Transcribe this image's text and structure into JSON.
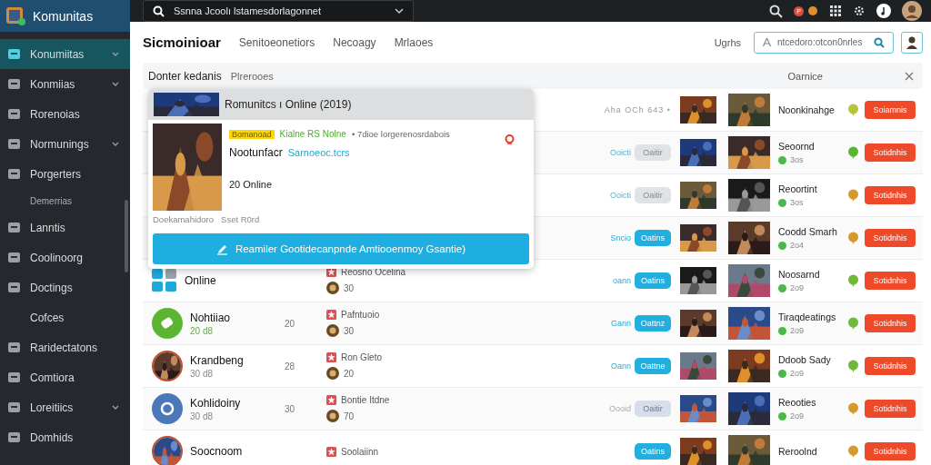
{
  "app": {
    "title": "Komunitas"
  },
  "topbar": {
    "search_value": "Ssnna Jcoolı lstamesdorlagonnet",
    "notification_badge": "P"
  },
  "sidebar": {
    "items": [
      {
        "label": "Konumiitas",
        "kind": "item",
        "selected": true,
        "expandable": true
      },
      {
        "label": "Konmiias",
        "kind": "item",
        "selected": false,
        "expandable": true
      },
      {
        "label": "Rorenoias",
        "kind": "item",
        "selected": false,
        "expandable": false
      },
      {
        "label": "Normunings",
        "kind": "item",
        "selected": false,
        "expandable": true
      },
      {
        "label": "Porgerters",
        "kind": "item",
        "selected": false,
        "expandable": false
      },
      {
        "label": "Demerrias",
        "kind": "sub",
        "selected": false,
        "expandable": false
      },
      {
        "label": "Lanntis",
        "kind": "item",
        "selected": false,
        "expandable": false
      },
      {
        "label": "Coolinoorg",
        "kind": "item",
        "selected": false,
        "expandable": false
      },
      {
        "label": "Doctings",
        "kind": "item",
        "selected": false,
        "expandable": false
      },
      {
        "label": "Cofces",
        "kind": "plain",
        "selected": false,
        "expandable": false
      },
      {
        "label": "Raridectatons",
        "kind": "item",
        "selected": false,
        "expandable": false
      },
      {
        "label": "Comtiora",
        "kind": "item",
        "selected": false,
        "expandable": false
      },
      {
        "label": "Loreitiics",
        "kind": "item",
        "selected": false,
        "expandable": true
      },
      {
        "label": "Domhids",
        "kind": "item",
        "selected": false,
        "expandable": false
      }
    ]
  },
  "tabs": [
    {
      "label": "Sicmoinioar",
      "selected": true
    },
    {
      "label": "Senitoeonetiors",
      "selected": false
    },
    {
      "label": "Necoagy",
      "selected": false
    },
    {
      "label": "Mrlaoes",
      "selected": false
    }
  ],
  "toolbar": {
    "label": "Ugrhs",
    "search_placeholder": "ntcedoro:otcon0nrles"
  },
  "filter_bar": {
    "title": "Donter kedanis",
    "subtitle": "Plrerooes",
    "right_label": "Oarnice"
  },
  "popup": {
    "title": "Romunitcs ı Online (2019)",
    "tag": "Bomanoad",
    "status": "Kialne RS Nolne",
    "meta": "• 7dioe lorgerenosrdabois",
    "name": "Nootunfacr",
    "link": "Sarnoeoc.tcrs",
    "online": "20 Online",
    "footer_left": "Doekamahidoro",
    "footer_right": "Sset R0rd",
    "button": "Reamiler Gootidecanpnde Amtiooenmoy Gsantie)"
  },
  "rows": [
    {
      "status": {
        "kind": "text",
        "label": "Aha OCh 643 •"
      },
      "title": "Noonkinahge",
      "color": "#b8c43a",
      "action": "Soiamnis"
    },
    {
      "status": {
        "kind": "idle",
        "label": "Ooicti",
        "button": "Oaitir"
      },
      "title": "Seoornd",
      "players": "3os",
      "color": "#5cb531",
      "action": "Sotidnhis"
    },
    {
      "status": {
        "kind": "idle",
        "label": "Ooicti",
        "button": "Oaitir"
      },
      "title": "Reoortint",
      "players": "3os",
      "color": "#d49a2e",
      "action": "Sotidnhis"
    },
    {
      "status": {
        "kind": "active",
        "label": "Sncio",
        "button": "Oatins"
      },
      "title": "Coodd Smarh",
      "players": "2o4",
      "color": "#d49a2e",
      "action": "Sotidnhis"
    },
    {
      "left": {
        "kind": "grid",
        "name": "Online"
      },
      "mid": {
        "title": "Reosno Ocelina",
        "value": "30"
      },
      "status": {
        "kind": "active",
        "label": "oann",
        "button": "Oatins"
      },
      "title": "Noosarnd",
      "players": "2o9",
      "color": "#6fb83a",
      "action": "Sotidnhis"
    },
    {
      "left": {
        "kind": "green",
        "name": "Nohtiiao",
        "sub": "20 d8"
      },
      "count": "20",
      "mid": {
        "title": "Pafntuoio",
        "value": "30"
      },
      "status": {
        "kind": "active",
        "label": "Gann",
        "button": "Oattnz"
      },
      "title": "Tiraqdeatings",
      "players": "2o9",
      "color": "#6fb83a",
      "action": "Sotidnhis"
    },
    {
      "left": {
        "name": "Krandbeng",
        "sub": "30 d8"
      },
      "count": "28",
      "mid": {
        "title": "Ron Gleto",
        "value": "20"
      },
      "status": {
        "kind": "active",
        "label": "Oann",
        "button": "Oattne"
      },
      "title": "Ddoob Sady",
      "players": "2o9",
      "color": "#6fb83a",
      "action": "Sotidnhis"
    },
    {
      "left": {
        "kind": "blue",
        "name": "Kohlidoiny",
        "sub": "30 d8"
      },
      "count": "30",
      "mid": {
        "title": "Bontie Itdne",
        "value": "70"
      },
      "status": {
        "kind": "faded",
        "label": "Oooid",
        "button": "Oaitir"
      },
      "title": "Reooties",
      "players": "2o9",
      "color": "#d49a2e",
      "action": "Sotidnhis"
    },
    {
      "left": {
        "name": "Soocnoom"
      },
      "mid": {
        "title": "Soolaiinn"
      },
      "status": {
        "kind": "active",
        "button": "Oatins"
      },
      "title": "Reroolnd",
      "color": "#d49a2e",
      "action": "Sotidnhis"
    }
  ]
}
